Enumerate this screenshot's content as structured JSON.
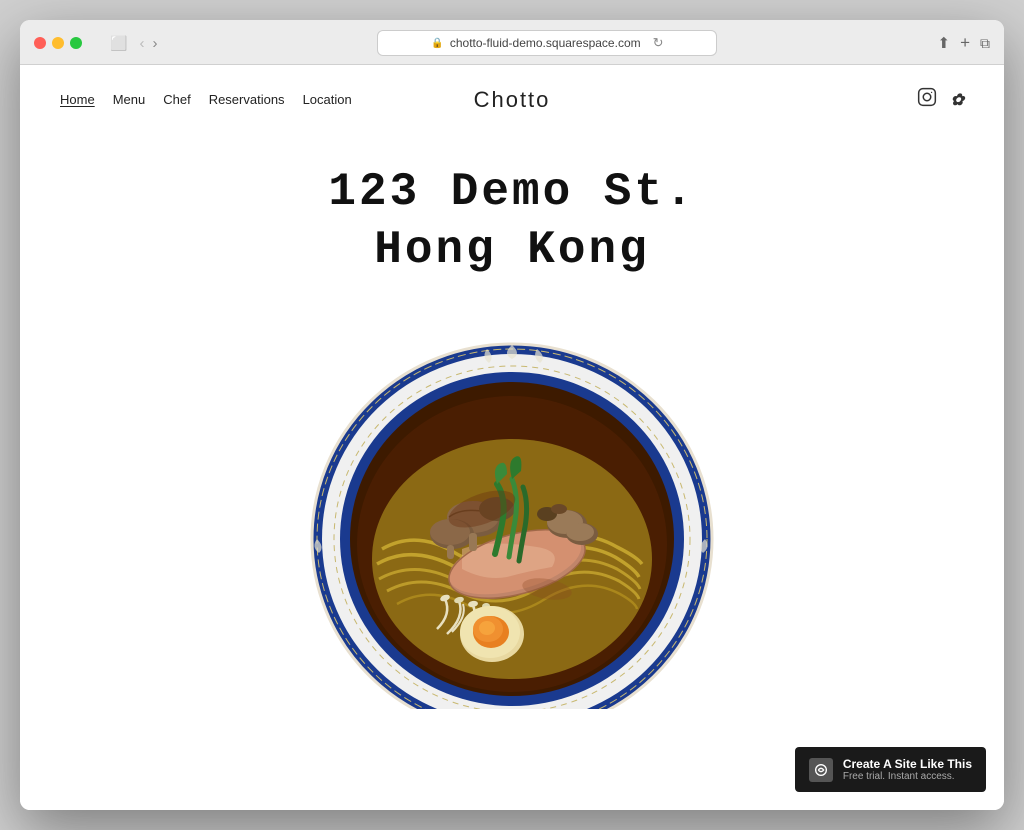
{
  "browser": {
    "url": "chotto-fluid-demo.squarespace.com",
    "traffic_lights": [
      "red",
      "yellow",
      "green"
    ]
  },
  "nav": {
    "links": [
      {
        "label": "Home",
        "active": true,
        "id": "home"
      },
      {
        "label": "Menu",
        "active": false,
        "id": "menu"
      },
      {
        "label": "Chef",
        "active": false,
        "id": "chef"
      },
      {
        "label": "Reservations",
        "active": false,
        "id": "reservations"
      },
      {
        "label": "Location",
        "active": false,
        "id": "location"
      }
    ],
    "site_title": "Chotto",
    "social": [
      {
        "name": "instagram",
        "glyph": "⬜"
      },
      {
        "name": "yelp",
        "glyph": "❊"
      }
    ]
  },
  "hero": {
    "address_line1": "123 Demo St.",
    "address_line2": "Hong Kong"
  },
  "badge": {
    "title": "Create A Site Like This",
    "subtitle": "Free trial. Instant access."
  }
}
